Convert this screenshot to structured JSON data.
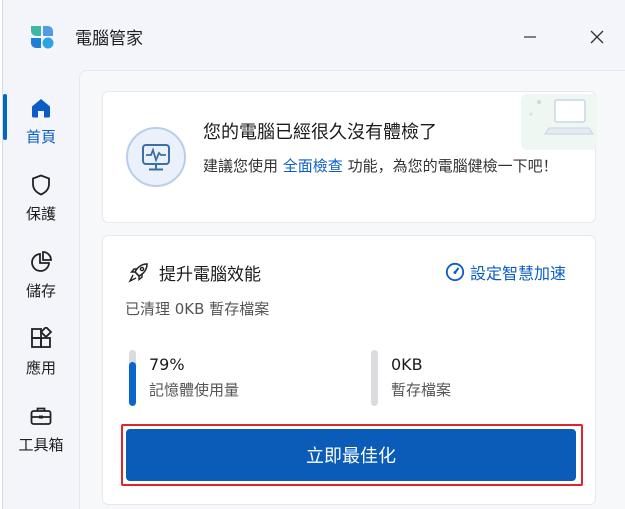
{
  "app": {
    "title": "電腦管家"
  },
  "window_controls": {
    "minimize_icon": "minimize-icon",
    "close_icon": "close-icon"
  },
  "sidebar": {
    "items": [
      {
        "label": "首頁",
        "icon": "home-icon",
        "active": true
      },
      {
        "label": "保護",
        "icon": "shield-icon",
        "active": false
      },
      {
        "label": "儲存",
        "icon": "pie-chart-icon",
        "active": false
      },
      {
        "label": "應用",
        "icon": "apps-icon",
        "active": false
      },
      {
        "label": "工具箱",
        "icon": "toolbox-icon",
        "active": false
      }
    ]
  },
  "health_card": {
    "title": "您的電腦已經很久沒有體檢了",
    "desc_before": "建議您使用 ",
    "desc_link": "全面檢查",
    "desc_after": " 功能，為您的電腦健檢一下吧！"
  },
  "performance_card": {
    "title": "提升電腦效能",
    "smart_link": "設定智慧加速",
    "cleaned_text": "已清理 0KB 暫存檔案",
    "stats": [
      {
        "value": "79%",
        "label": "記憶體使用量",
        "fill_percent": 79
      },
      {
        "value": "0KB",
        "label": "暫存檔案",
        "fill_percent": 0
      }
    ],
    "button": "立即最佳化"
  },
  "colors": {
    "accent": "#0a5cb8",
    "highlight_outline": "#e0242b"
  }
}
